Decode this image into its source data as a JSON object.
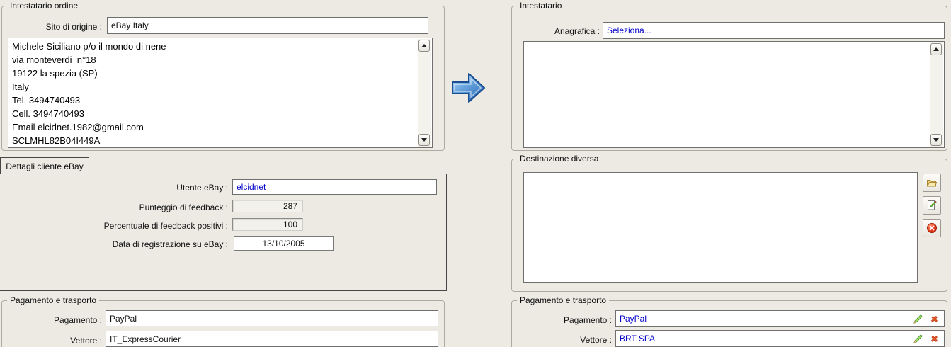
{
  "colors": {
    "window_bg": "#ECEAE3",
    "link_text_blue": "#0000C8",
    "arrow_blue": "#3C7FC2",
    "delete_red": "#D7421C",
    "folder_yellow": "#EFD27A",
    "pencil_green": "#8FD35F"
  },
  "icons": {
    "transfer_arrow": "blue-right-arrow",
    "open_folder": "open-folder",
    "edit_note": "page-with-pencil",
    "delete_circle": "red-circle-x",
    "edit_pencil": "green-pencil",
    "remove_x": "orange-x",
    "scroll_up": "▲",
    "scroll_down": "▼"
  },
  "left_panel": {
    "order_group": {
      "title": "Intestatario ordine",
      "site_label": "Sito di origine :",
      "site_value": "eBay Italy",
      "address": "Michele Siciliano p/o il mondo di nene\nvia monteverdi  n°18\n19122 la spezia (SP)\nItaly\nTel. 3494740493\nCell. 3494740493\nEmail elcidnet.1982@gmail.com\nSCLMHL82B04I449A"
    },
    "details_tab": {
      "label": "Dettagli cliente eBay",
      "user_label": "Utente eBay :",
      "user_value": "elcidnet",
      "feedback_score_label": "Punteggio di feedback :",
      "feedback_score_value": "287",
      "feedback_pct_label": "Percentuale di feedback positivi :",
      "feedback_pct_value": "100",
      "reg_date_label": "Data di registrazione su eBay :",
      "reg_date_value": "13/10/2005"
    },
    "payment_group": {
      "title": "Pagamento e trasporto",
      "payment_label": "Pagamento :",
      "payment_value": "PayPal",
      "carrier_label": "Vettore :",
      "carrier_value": "IT_ExpressCourier"
    }
  },
  "right_panel": {
    "header_group": {
      "title": "Intestatario",
      "anagrafica_label": "Anagrafica :",
      "anagrafica_value": "Seleziona...",
      "address": ""
    },
    "destination_group": {
      "title": "Destinazione diversa",
      "address": ""
    },
    "payment_group": {
      "title": "Pagamento e trasporto",
      "payment_label": "Pagamento :",
      "payment_value": "PayPal",
      "carrier_label": "Vettore :",
      "carrier_value": "BRT SPA"
    }
  }
}
